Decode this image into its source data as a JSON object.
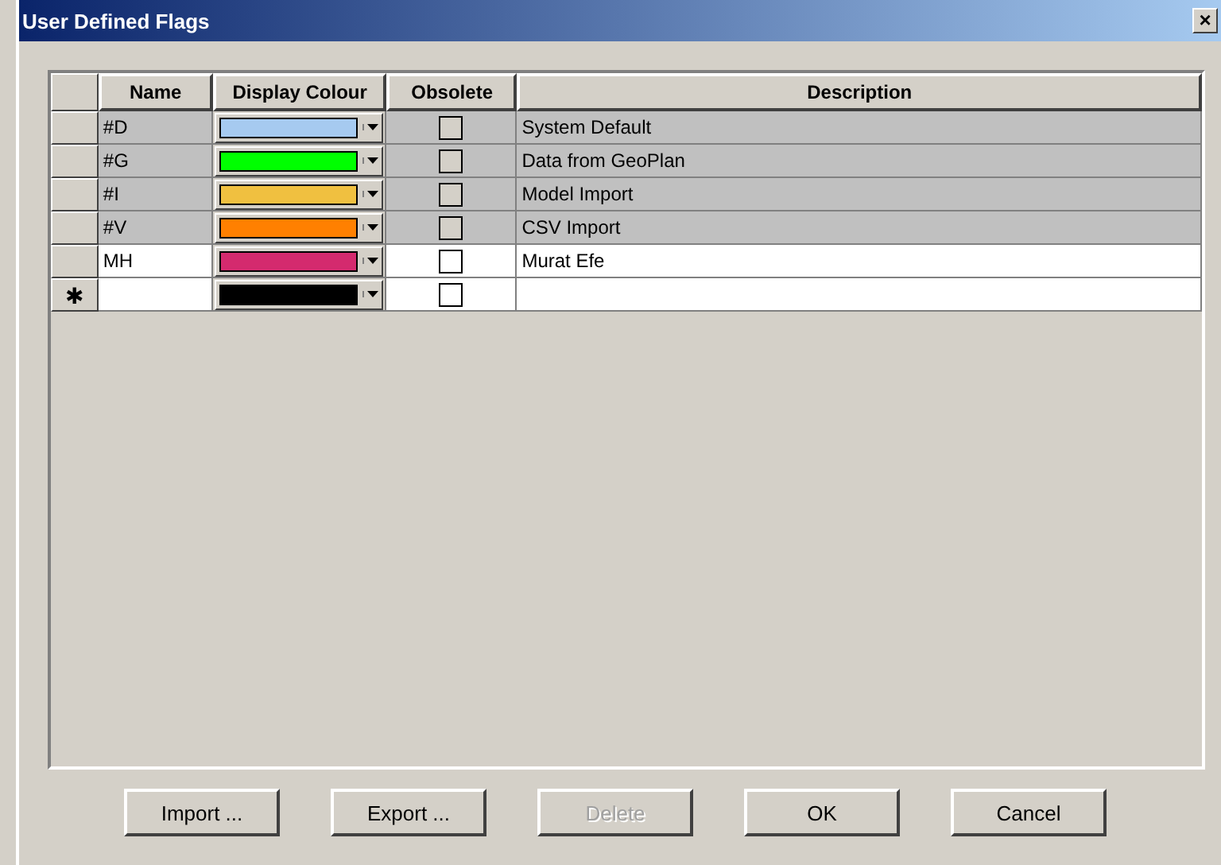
{
  "window": {
    "title": "User Defined Flags",
    "close": "×"
  },
  "table": {
    "columns": [
      "Name",
      "Display Colour",
      "Obsolete",
      "Description"
    ],
    "rows": [
      {
        "name": "#D",
        "color": "#a6caf0",
        "obsolete": false,
        "description": "System Default",
        "locked": true
      },
      {
        "name": "#G",
        "color": "#00ff00",
        "obsolete": false,
        "description": "Data from GeoPlan",
        "locked": true
      },
      {
        "name": "#I",
        "color": "#f0c040",
        "obsolete": false,
        "description": "Model Import",
        "locked": true
      },
      {
        "name": "#V",
        "color": "#ff8000",
        "obsolete": false,
        "description": "CSV Import",
        "locked": true
      },
      {
        "name": "MH",
        "color": "#d42a6e",
        "obsolete": false,
        "description": "Murat Efe",
        "locked": false
      }
    ],
    "new_row": {
      "marker": "✱",
      "color": "#000000",
      "obsolete": false
    }
  },
  "buttons": [
    {
      "label": "Import ...",
      "disabled": false
    },
    {
      "label": "Export ...",
      "disabled": false
    },
    {
      "label": "Delete",
      "disabled": true
    },
    {
      "label": "OK",
      "disabled": false
    },
    {
      "label": "Cancel",
      "disabled": false
    }
  ]
}
